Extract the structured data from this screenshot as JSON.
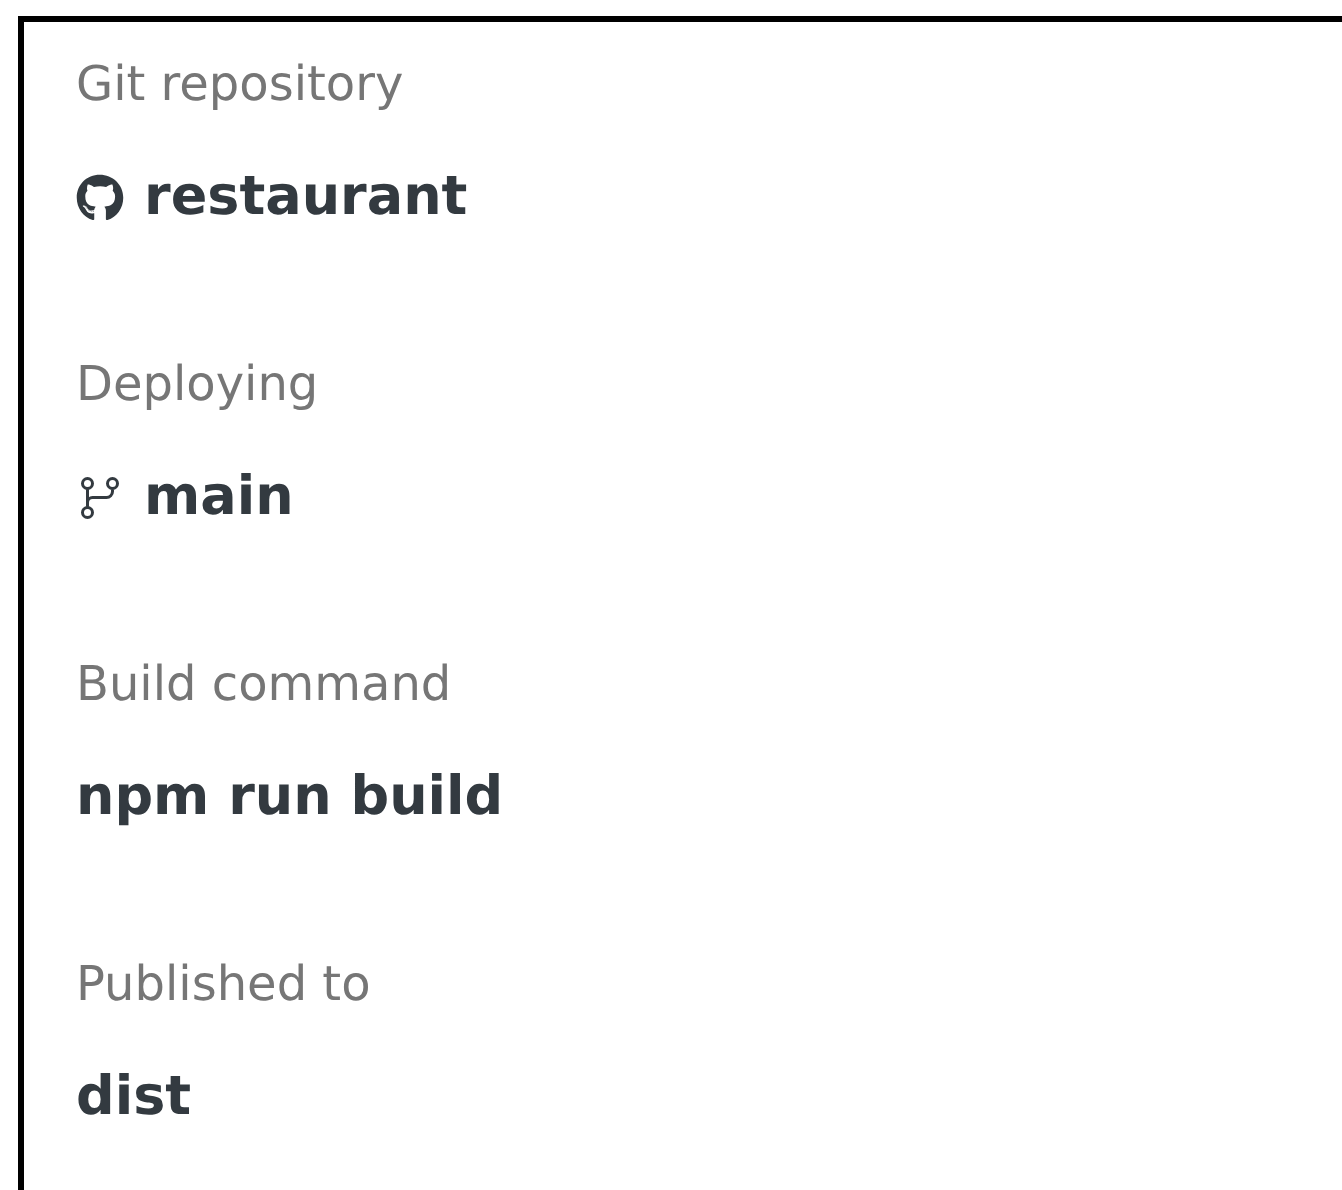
{
  "fields": [
    {
      "label": "Git repository",
      "value": "restaurant",
      "kind": "repository"
    },
    {
      "label": "Deploying",
      "value": "main",
      "kind": "branch"
    },
    {
      "label": "Build command",
      "value": "npm run build",
      "kind": "plain"
    },
    {
      "label": "Published to",
      "value": "dist",
      "kind": "plain"
    }
  ]
}
